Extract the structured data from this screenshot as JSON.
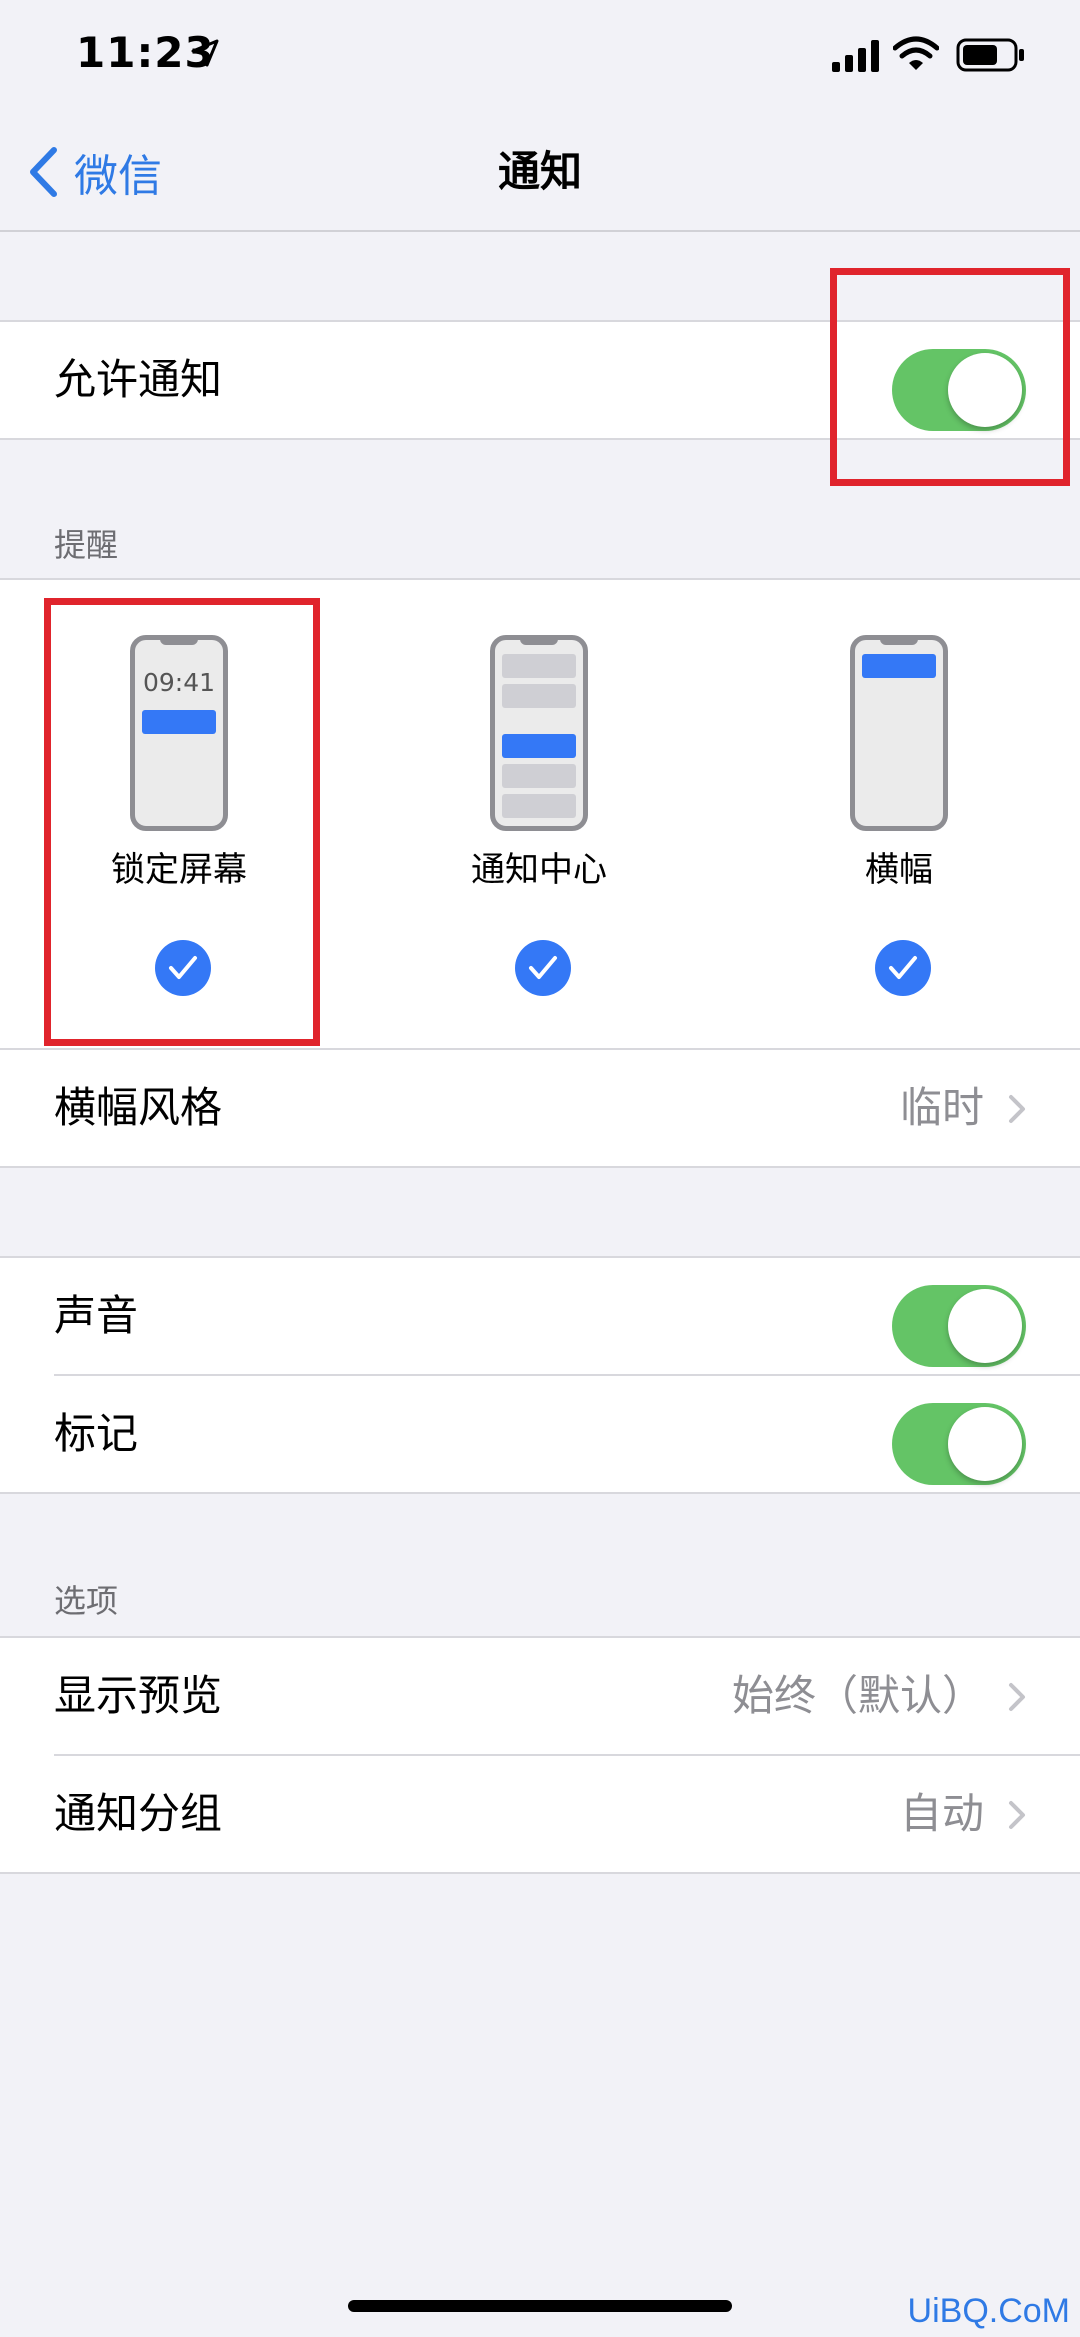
{
  "status_bar": {
    "time": "11:23"
  },
  "nav": {
    "back_label": "微信",
    "title": "通知"
  },
  "allow": {
    "label": "允许通知",
    "on": true
  },
  "alerts": {
    "header": "提醒",
    "styles": [
      {
        "label": "锁定屏幕",
        "preview_time": "09:41",
        "checked": true
      },
      {
        "label": "通知中心",
        "checked": true
      },
      {
        "label": "横幅",
        "checked": true
      }
    ],
    "banner_style": {
      "label": "横幅风格",
      "value": "临时"
    }
  },
  "sound": {
    "label": "声音",
    "on": true
  },
  "badges": {
    "label": "标记",
    "on": true
  },
  "options": {
    "header": "选项",
    "show_previews": {
      "label": "显示预览",
      "value": "始终（默认）"
    },
    "grouping": {
      "label": "通知分组",
      "value": "自动"
    }
  },
  "watermark": "UiBQ.CoM",
  "colors": {
    "accent": "#3478f6",
    "toggle_on": "#64c466",
    "annotation": "#e0242c"
  }
}
